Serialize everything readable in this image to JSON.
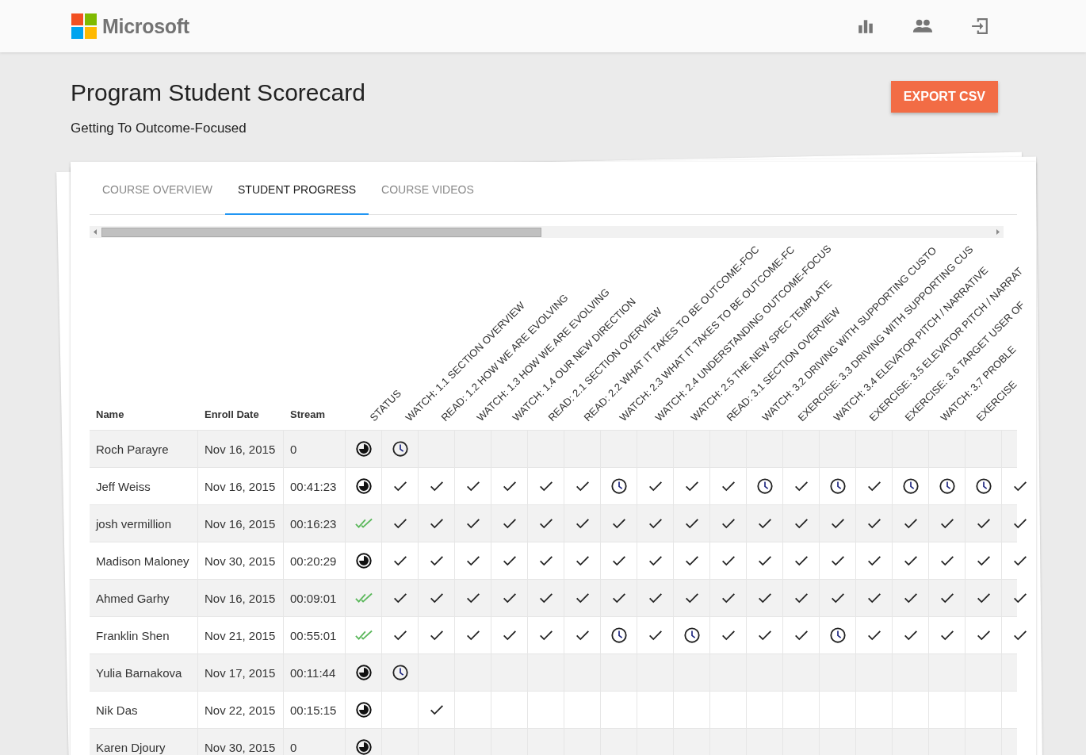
{
  "brand": "Microsoft",
  "title": "Program Student Scorecard",
  "subtitle": "Getting To Outcome-Focused",
  "export_button": "EXPORT CSV",
  "tabs": [
    {
      "label": "COURSE OVERVIEW",
      "selected": false
    },
    {
      "label": "STUDENT PROGRESS",
      "selected": true
    },
    {
      "label": "COURSE VIDEOS",
      "selected": false
    }
  ],
  "table": {
    "columns": [
      "Name",
      "Enroll Date",
      "Stream"
    ],
    "activity_columns": [
      "STATUS",
      "WATCH: 1.1 SECTION OVERVIEW",
      "READ: 1.2 HOW WE ARE EVOLVING",
      "WATCH: 1.3 HOW WE ARE EVOLVING",
      "WATCH: 1.4 OUR NEW DIRECTION",
      "READ: 2.1 SECTION OVERVIEW",
      "READ: 2.2 WHAT IT TAKES TO BE OUTCOME-FOC",
      "WATCH: 2.3 WHAT IT TAKES TO BE OUTCOME-FC",
      "WATCH: 2.4 UNDERSTANDING OUTCOME-FOCUS",
      "WATCH: 2.5 THE NEW SPEC TEMPLATE",
      "READ: 3.1 SECTION OVERVIEW",
      "WATCH: 3.2 DRIVING WITH SUPPORTING CUSTO",
      "EXERCISE: 3.3 DRIVING WITH SUPPORTING CUS",
      "WATCH: 3.4 ELEVATOR PITCH / NARRATIVE",
      "EXERCISE: 3.5 ELEVATOR PITCH / NARRAT",
      "EXERCISE: 3.6 TARGET USER OF",
      "WATCH: 3.7 PROBLE",
      "EXERCISE"
    ],
    "rows": [
      {
        "name": "Roch Parayre",
        "enroll_date": "Nov 16, 2015",
        "stream": "0",
        "status": {
          "kind": "partial"
        },
        "cells": [
          {
            "kind": "clock"
          },
          {
            "kind": "empty"
          },
          {
            "kind": "empty"
          },
          {
            "kind": "empty"
          },
          {
            "kind": "empty"
          },
          {
            "kind": "empty"
          },
          {
            "kind": "empty"
          },
          {
            "kind": "empty"
          },
          {
            "kind": "empty"
          },
          {
            "kind": "empty"
          },
          {
            "kind": "empty"
          },
          {
            "kind": "empty"
          },
          {
            "kind": "empty"
          },
          {
            "kind": "empty"
          },
          {
            "kind": "empty"
          },
          {
            "kind": "empty"
          },
          {
            "kind": "empty"
          },
          {
            "kind": "empty"
          }
        ]
      },
      {
        "name": "Jeff Weiss",
        "enroll_date": "Nov 16, 2015",
        "stream": "00:41:23",
        "status": {
          "kind": "partial"
        },
        "cells": [
          {
            "kind": "check"
          },
          {
            "kind": "check"
          },
          {
            "kind": "check"
          },
          {
            "kind": "check"
          },
          {
            "kind": "check"
          },
          {
            "kind": "check"
          },
          {
            "kind": "clock"
          },
          {
            "kind": "check"
          },
          {
            "kind": "check"
          },
          {
            "kind": "check"
          },
          {
            "kind": "clock"
          },
          {
            "kind": "check"
          },
          {
            "kind": "clock"
          },
          {
            "kind": "check"
          },
          {
            "kind": "clock"
          },
          {
            "kind": "clock"
          },
          {
            "kind": "clock"
          },
          {
            "kind": "check"
          }
        ]
      },
      {
        "name": "josh vermillion",
        "enroll_date": "Nov 16, 2015",
        "stream": "00:16:23",
        "status": {
          "kind": "done"
        },
        "cells": [
          {
            "kind": "check"
          },
          {
            "kind": "check"
          },
          {
            "kind": "check"
          },
          {
            "kind": "check"
          },
          {
            "kind": "check"
          },
          {
            "kind": "check"
          },
          {
            "kind": "check"
          },
          {
            "kind": "check"
          },
          {
            "kind": "check"
          },
          {
            "kind": "check"
          },
          {
            "kind": "check"
          },
          {
            "kind": "check"
          },
          {
            "kind": "check"
          },
          {
            "kind": "check"
          },
          {
            "kind": "check"
          },
          {
            "kind": "check"
          },
          {
            "kind": "check"
          },
          {
            "kind": "check"
          }
        ]
      },
      {
        "name": "Madison Maloney",
        "enroll_date": "Nov 30, 2015",
        "stream": "00:20:29",
        "status": {
          "kind": "partial"
        },
        "cells": [
          {
            "kind": "check"
          },
          {
            "kind": "check"
          },
          {
            "kind": "check"
          },
          {
            "kind": "check"
          },
          {
            "kind": "check"
          },
          {
            "kind": "check"
          },
          {
            "kind": "check"
          },
          {
            "kind": "check"
          },
          {
            "kind": "check"
          },
          {
            "kind": "check"
          },
          {
            "kind": "check"
          },
          {
            "kind": "check"
          },
          {
            "kind": "check"
          },
          {
            "kind": "check"
          },
          {
            "kind": "check"
          },
          {
            "kind": "check"
          },
          {
            "kind": "check"
          },
          {
            "kind": "check"
          }
        ]
      },
      {
        "name": "Ahmed Garhy",
        "enroll_date": "Nov 16, 2015",
        "stream": "00:09:01",
        "status": {
          "kind": "done"
        },
        "cells": [
          {
            "kind": "check"
          },
          {
            "kind": "check"
          },
          {
            "kind": "check"
          },
          {
            "kind": "check"
          },
          {
            "kind": "check"
          },
          {
            "kind": "check"
          },
          {
            "kind": "check"
          },
          {
            "kind": "check"
          },
          {
            "kind": "check"
          },
          {
            "kind": "check"
          },
          {
            "kind": "check"
          },
          {
            "kind": "check"
          },
          {
            "kind": "check"
          },
          {
            "kind": "check"
          },
          {
            "kind": "check"
          },
          {
            "kind": "check"
          },
          {
            "kind": "check"
          },
          {
            "kind": "check"
          }
        ]
      },
      {
        "name": "Franklin Shen",
        "enroll_date": "Nov 21, 2015",
        "stream": "00:55:01",
        "status": {
          "kind": "done"
        },
        "cells": [
          {
            "kind": "check"
          },
          {
            "kind": "check"
          },
          {
            "kind": "check"
          },
          {
            "kind": "check"
          },
          {
            "kind": "check"
          },
          {
            "kind": "check"
          },
          {
            "kind": "clock"
          },
          {
            "kind": "check"
          },
          {
            "kind": "clock"
          },
          {
            "kind": "check"
          },
          {
            "kind": "check"
          },
          {
            "kind": "check"
          },
          {
            "kind": "clock"
          },
          {
            "kind": "check"
          },
          {
            "kind": "check"
          },
          {
            "kind": "check"
          },
          {
            "kind": "check"
          },
          {
            "kind": "check"
          }
        ]
      },
      {
        "name": "Yulia Barnakova",
        "enroll_date": "Nov 17, 2015",
        "stream": "00:11:44",
        "status": {
          "kind": "partial"
        },
        "cells": [
          {
            "kind": "clock"
          },
          {
            "kind": "empty"
          },
          {
            "kind": "empty"
          },
          {
            "kind": "empty"
          },
          {
            "kind": "empty"
          },
          {
            "kind": "empty"
          },
          {
            "kind": "empty"
          },
          {
            "kind": "empty"
          },
          {
            "kind": "empty"
          },
          {
            "kind": "empty"
          },
          {
            "kind": "empty"
          },
          {
            "kind": "empty"
          },
          {
            "kind": "empty"
          },
          {
            "kind": "empty"
          },
          {
            "kind": "empty"
          },
          {
            "kind": "empty"
          },
          {
            "kind": "empty"
          },
          {
            "kind": "empty"
          }
        ]
      },
      {
        "name": "Nik Das",
        "enroll_date": "Nov 22, 2015",
        "stream": "00:15:15",
        "status": {
          "kind": "partial"
        },
        "cells": [
          {
            "kind": "empty"
          },
          {
            "kind": "check"
          },
          {
            "kind": "empty"
          },
          {
            "kind": "empty"
          },
          {
            "kind": "empty"
          },
          {
            "kind": "empty"
          },
          {
            "kind": "empty"
          },
          {
            "kind": "empty"
          },
          {
            "kind": "empty"
          },
          {
            "kind": "empty"
          },
          {
            "kind": "empty"
          },
          {
            "kind": "empty"
          },
          {
            "kind": "empty"
          },
          {
            "kind": "empty"
          },
          {
            "kind": "empty"
          },
          {
            "kind": "empty"
          },
          {
            "kind": "empty"
          },
          {
            "kind": "empty"
          }
        ]
      },
      {
        "name": "Karen Djoury",
        "enroll_date": "Nov 30, 2015",
        "stream": "0",
        "status": {
          "kind": "partial"
        },
        "cells": [
          {
            "kind": "empty"
          },
          {
            "kind": "empty"
          },
          {
            "kind": "empty"
          },
          {
            "kind": "empty"
          },
          {
            "kind": "empty"
          },
          {
            "kind": "empty"
          },
          {
            "kind": "empty"
          },
          {
            "kind": "empty"
          },
          {
            "kind": "empty"
          },
          {
            "kind": "empty"
          },
          {
            "kind": "empty"
          },
          {
            "kind": "empty"
          },
          {
            "kind": "empty"
          },
          {
            "kind": "empty"
          },
          {
            "kind": "empty"
          },
          {
            "kind": "empty"
          },
          {
            "kind": "empty"
          },
          {
            "kind": "empty"
          }
        ]
      }
    ]
  }
}
